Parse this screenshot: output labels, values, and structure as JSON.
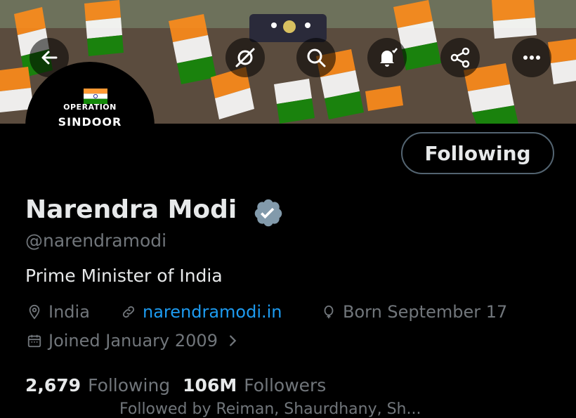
{
  "header": {
    "icons": [
      "back-arrow-icon",
      "grok-icon",
      "search-icon",
      "notification-bell-icon",
      "share-icon",
      "more-icon"
    ]
  },
  "avatar": {
    "line1": "OPERATION",
    "line2": "SINDOOR"
  },
  "profile": {
    "follow_label": "Following",
    "name": "Narendra Modi",
    "handle": "@narendramodi",
    "bio": "Prime Minister of India",
    "location": "India",
    "website": "narendramodi.in",
    "birthday": "Born September 17",
    "joined": "Joined January 2009",
    "following_count": "2,679",
    "following_label": "Following",
    "followers_count": "106M",
    "followers_label": "Followers",
    "followed_by_partial": "Followed by Reiman, Shaurdhany, Sh..."
  },
  "colors": {
    "accent": "#1d9bf0",
    "muted": "#71767b",
    "text": "#e7e9ea",
    "verified_badge": "#829aab"
  }
}
